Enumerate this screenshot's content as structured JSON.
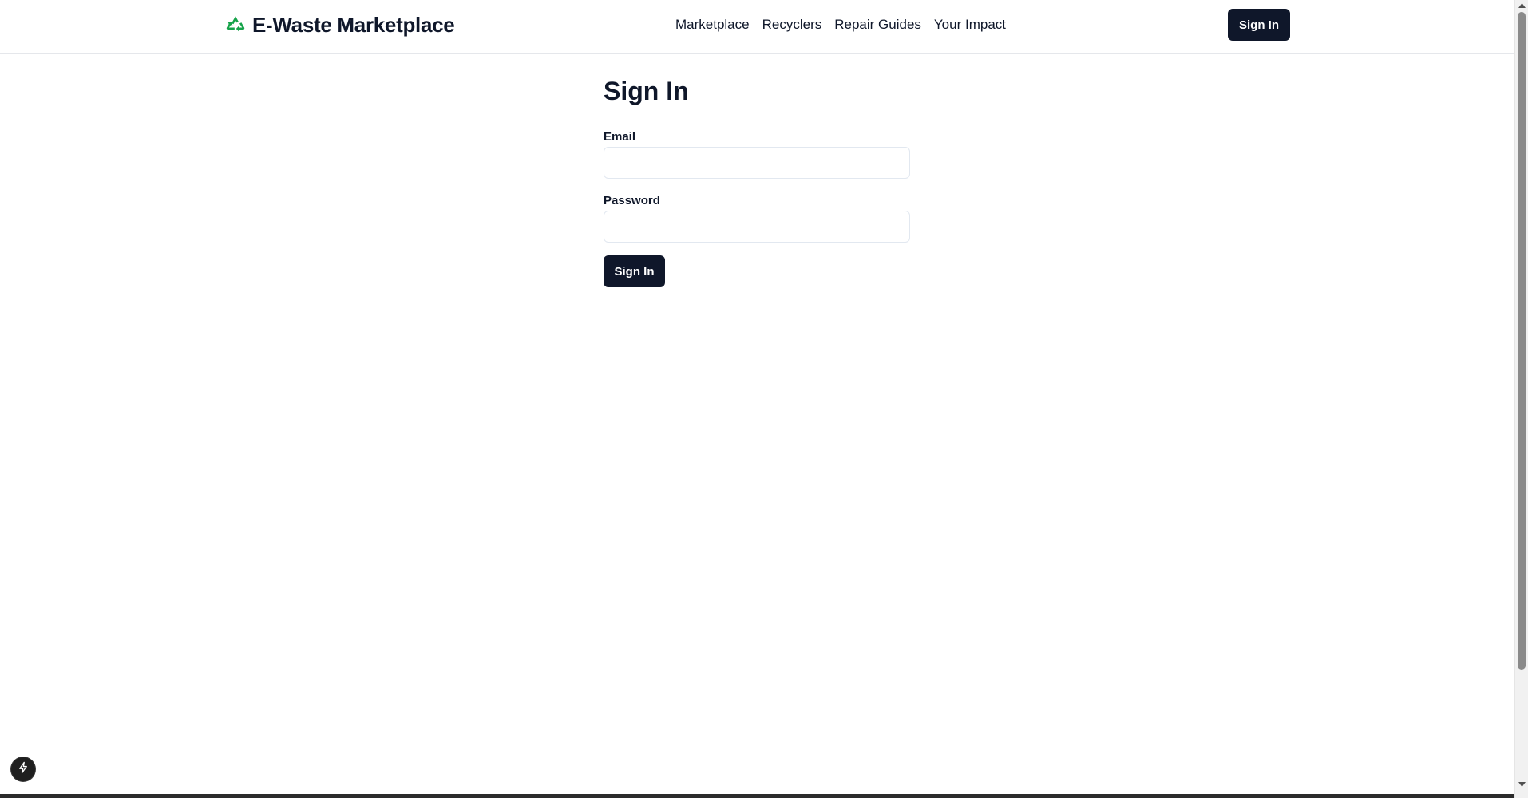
{
  "header": {
    "brand": {
      "name": "E-Waste Marketplace",
      "icon": "recycle-icon",
      "icon_color": "#16a34a"
    },
    "nav": [
      {
        "label": "Marketplace"
      },
      {
        "label": "Recyclers"
      },
      {
        "label": "Repair Guides"
      },
      {
        "label": "Your Impact"
      }
    ],
    "signin_label": "Sign In"
  },
  "form": {
    "title": "Sign In",
    "email": {
      "label": "Email",
      "value": "",
      "placeholder": ""
    },
    "password": {
      "label": "Password",
      "value": "",
      "placeholder": ""
    },
    "submit_label": "Sign In"
  },
  "colors": {
    "primary": "#0f172a",
    "brand_green": "#16a34a",
    "border": "#e2e8f0"
  },
  "dev_badge": {
    "icon": "lightning-icon"
  },
  "scrollbar": {
    "icons": [
      "scroll-up-arrow-icon",
      "scroll-down-arrow-icon"
    ]
  }
}
